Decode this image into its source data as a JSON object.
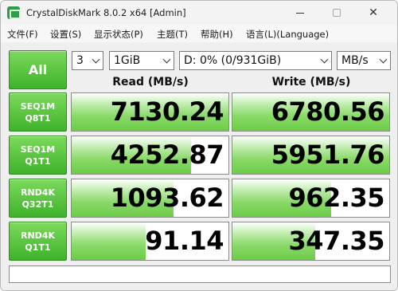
{
  "window": {
    "title": "CrystalDiskMark 8.0.2 x64 [Admin]"
  },
  "menu": [
    {
      "label": "文件(F)"
    },
    {
      "label": "设置(S)"
    },
    {
      "label": "显示状态(P)"
    },
    {
      "label": "主题(T)"
    },
    {
      "label": "帮助(H)"
    },
    {
      "label": "语言(L)(Language)"
    }
  ],
  "controls": {
    "all_label": "All",
    "count": "3",
    "size": "1GiB",
    "drive": "D: 0% (0/931GiB)",
    "unit": "MB/s"
  },
  "headers": {
    "read": "Read (MB/s)",
    "write": "Write (MB/s)"
  },
  "tests": [
    {
      "line1": "SEQ1M",
      "line2": "Q8T1",
      "read": "7130.24",
      "write": "6780.56",
      "read_level": 1.0,
      "write_level": 1.0
    },
    {
      "line1": "SEQ1M",
      "line2": "Q1T1",
      "read": "4252.87",
      "write": "5951.76",
      "read_level": 0.76,
      "write_level": 1.0
    },
    {
      "line1": "RND4K",
      "line2": "Q32T1",
      "read": "1093.62",
      "write": "962.35",
      "read_level": 0.65,
      "write_level": 0.63
    },
    {
      "line1": "RND4K",
      "line2": "Q1T1",
      "read": "91.14",
      "write": "347.35",
      "read_level": 0.47,
      "write_level": 0.53
    }
  ],
  "comment": ""
}
